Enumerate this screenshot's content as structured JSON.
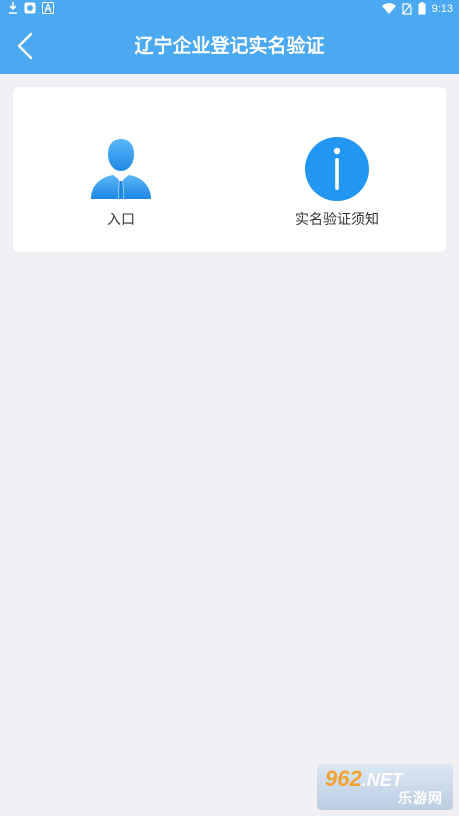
{
  "status_bar": {
    "time": "9:13"
  },
  "header": {
    "title": "辽宁企业登记实名验证"
  },
  "tiles": {
    "entry_label": "入口",
    "info_label": "实名验证须知"
  },
  "watermark": {
    "brand": "962",
    "domain": ".NET",
    "text": "乐游网"
  },
  "colors": {
    "header_bg": "#4aa9f0",
    "page_bg": "#efeff4",
    "icon_blue": "#2196f3"
  }
}
